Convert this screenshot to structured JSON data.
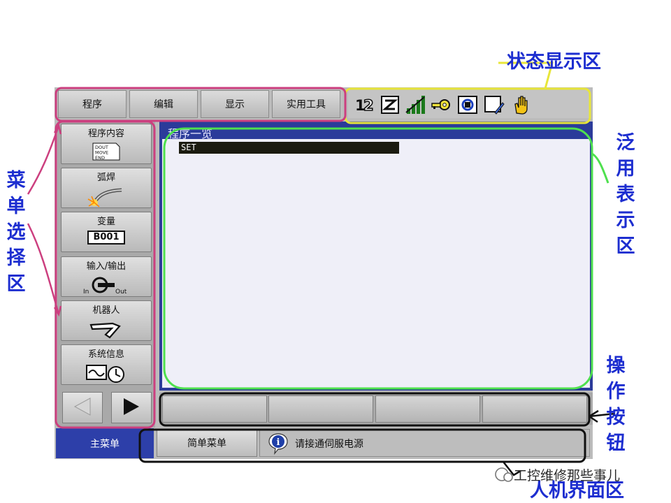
{
  "menu_tabs": [
    "程序",
    "编辑",
    "显示",
    "实用工具"
  ],
  "status_icons": [
    "axis-order-icon",
    "coordinate-system-icon",
    "speed-level-icon",
    "security-key-icon",
    "cycle-mode-icon",
    "edit-lock-icon",
    "teach-mode-hand-icon"
  ],
  "side_menu": {
    "items": [
      {
        "label": "程序内容",
        "icon": "job-document-icon",
        "doc_lines": [
          "DOUT",
          "MOVE",
          "END"
        ]
      },
      {
        "label": "弧焊",
        "icon": "arc-welding-torch-icon"
      },
      {
        "label": "变量",
        "icon": "variable-icon",
        "value": "B001"
      },
      {
        "label": "输入/输出",
        "icon": "io-connector-icon",
        "in_label": "In",
        "out_label": "Out"
      },
      {
        "label": "机器人",
        "icon": "robot-arm-icon"
      },
      {
        "label": "系统信息",
        "icon": "system-info-icon"
      }
    ],
    "prev_icon": "page-left-arrow-icon",
    "next_icon": "page-right-arrow-icon"
  },
  "general_display": {
    "title": "程序一览",
    "selected_line": "SET"
  },
  "operation_buttons": [
    "",
    "",
    "",
    ""
  ],
  "bottom": {
    "main_menu": "主菜单",
    "simple_menu": "简单菜单",
    "message": "请接通伺服电源",
    "info_icon": "info-icon"
  },
  "annotations": {
    "status_area": "状态显示区",
    "menu_select_area": "菜单选择区",
    "general_display_area": "泛用表示区",
    "operation_buttons": "操作按钮",
    "hmi_area": "人机界面区",
    "watermark": "工控维修那些事儿",
    "colors": {
      "pink": "#cc3f7f",
      "yellow": "#e8e63a",
      "green": "#4ee04e",
      "black": "#111111",
      "label_blue": "#1d2ed0"
    }
  }
}
